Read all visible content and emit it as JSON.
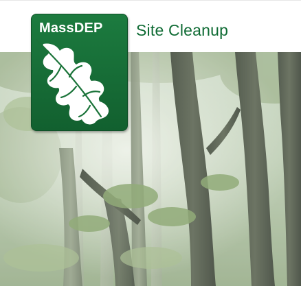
{
  "logo": {
    "text": "MassDEP",
    "icon": "oak-leaf-icon"
  },
  "header": {
    "site_title": "Site Cleanup"
  },
  "colors": {
    "brand_green": "#12602f",
    "title_green": "#0f6b34"
  }
}
